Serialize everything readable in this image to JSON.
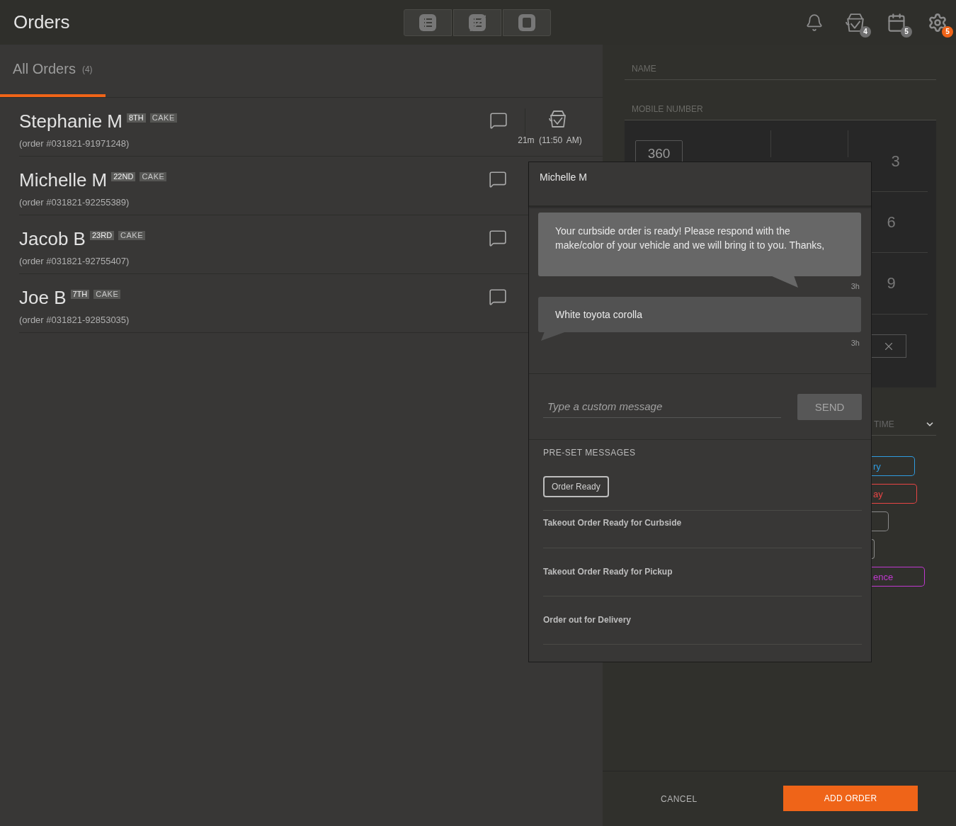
{
  "header": {
    "title": "Orders",
    "view_switch": [
      {
        "kind": "list"
      },
      {
        "kind": "hidden-list"
      },
      {
        "kind": "square"
      }
    ],
    "icons": [
      {
        "kind": "bell"
      },
      {
        "kind": "takeout",
        "badge": "4",
        "color": "#6f6f6f"
      },
      {
        "kind": "calendar",
        "badge": "5",
        "color": "#6f6f6f"
      },
      {
        "kind": "gear",
        "badge": "5",
        "color": "#f06418"
      }
    ]
  },
  "orders_tab": {
    "label": "All Orders",
    "count": "(4)",
    "selected": true
  },
  "orders": [
    {
      "name": "Stephanie M",
      "seat": "8TH",
      "tag": "CAKE",
      "order_no": "(order #031821-91971248)",
      "elapsed": "21m",
      "time": "(11:50 AM)"
    },
    {
      "name": "Michelle M",
      "seat": "22ND",
      "tag": "CAKE",
      "order_no": "(order #031821-92255389)"
    },
    {
      "name": "Jacob B",
      "seat": "23RD",
      "tag": "CAKE",
      "order_no": "(order #031821-92755407)"
    },
    {
      "name": "Joe B",
      "seat": "7TH",
      "tag": "CAKE",
      "order_no": "(order #031821-92853035)"
    }
  ],
  "form": {
    "name_label": "NAME",
    "mobile_label": "MOBILE NUMBER",
    "area_code": "360",
    "keys": [
      "3",
      "6",
      "9"
    ],
    "time_label": "TIME",
    "tags": [
      {
        "text": "ry",
        "color": "#2f9be0"
      },
      {
        "text": "ay",
        "color": "#e84545"
      },
      {
        "color": "#8a8a8a"
      },
      {
        "color": "#8a8a8a"
      },
      {
        "text": "ence",
        "color": "#c038d0"
      }
    ]
  },
  "footer": {
    "cancel": "CANCEL",
    "add": "ADD ORDER"
  },
  "chat": {
    "name": "Michelle M",
    "messages": [
      {
        "kind": "sent",
        "text": "Your curbside order is ready! Please respond with the make/color of your vehicle and we will bring it to you. Thanks,",
        "time": "3h"
      },
      {
        "kind": "received",
        "text": "White toyota corolla",
        "time": "3h"
      }
    ],
    "placeholder": "Type a custom message",
    "send": "SEND",
    "presets_title": "PRE-SET MESSAGES",
    "presets": [
      {
        "kind": "chip",
        "label": "Order Ready"
      },
      {
        "kind": "row",
        "label": "Takeout Order Ready for Curbside"
      },
      {
        "kind": "row",
        "label": "Takeout Order Ready for Pickup"
      },
      {
        "kind": "row",
        "label": "Order out for Delivery"
      }
    ]
  }
}
